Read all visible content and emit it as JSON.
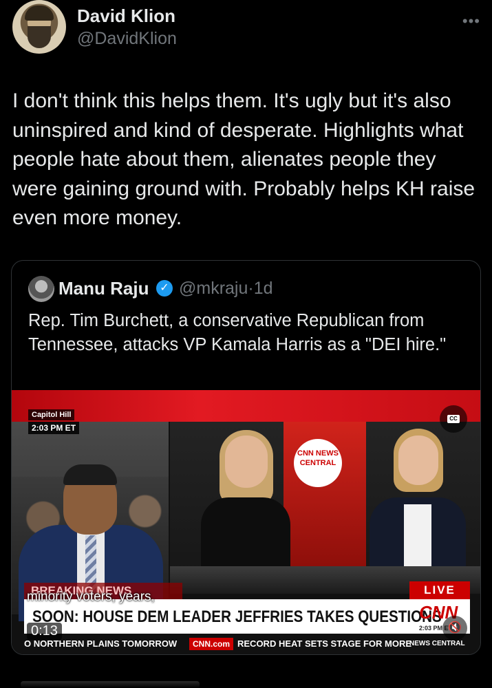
{
  "author": {
    "name": "David Klion",
    "handle": "@DavidKlion",
    "more_icon": "more-dots-icon"
  },
  "tweet": {
    "text": "I don't think this helps them. It's ugly but it's also uninspired and kind of desperate. Highlights what people hate about them, alienates people they were gaining ground with. Probably helps KH raise even more money."
  },
  "quote": {
    "name": "Manu Raju",
    "handle": "@mkraju",
    "age": "1d",
    "verified": "verified-badge-icon",
    "text": "Rep. Tim Burchett, a conservative Republican from Tennessee, attacks VP Kamala Harris as a \"DEI hire.\"",
    "video": {
      "location": "Capitol Hill",
      "location_time": "2:03 PM ET",
      "cc_label": "CC",
      "studio_logo": "CNN NEWS CENTRAL",
      "breaking": "BREAKING NEWS",
      "live": "LIVE",
      "headline": "SOON: HOUSE DEM LEADER JEFFRIES TAKES QUESTIONS",
      "network": "CNN",
      "network_time": "2:03 PM ET",
      "ticker_1": "O NORTHERN PLAINS TOMORROW",
      "ticker_site": "CNN.com",
      "ticker_2": "RECORD HEAT SETS STAGE FOR MORE",
      "ticker_show": "NEWS CENTRAL",
      "caption": "minority voters, years,",
      "duration": "0:13",
      "mute_icon": "speaker-muted-icon"
    }
  },
  "colors": {
    "background": "#000000",
    "text": "#e7e9ea",
    "secondary": "#71767b",
    "verified": "#1d9bf0",
    "cnn_red": "#cc0000"
  }
}
